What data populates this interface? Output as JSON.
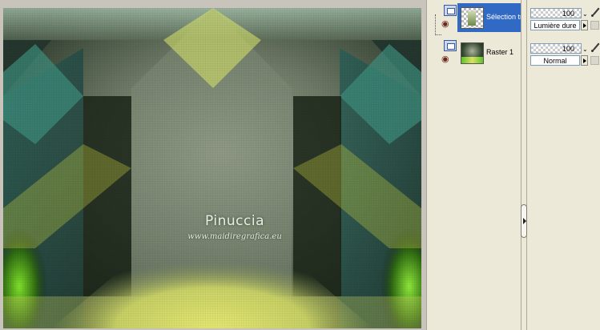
{
  "canvas": {
    "watermark_title": "Pinuccia",
    "watermark_subtitle": "www.maidiregrafica.eu"
  },
  "layers": [
    {
      "name": "Sélection transformée",
      "opacity": "100",
      "blend_mode": "Lumière dure",
      "selected": true,
      "icon": "raster-layer-icon"
    },
    {
      "name": "Raster 1",
      "opacity": "100",
      "blend_mode": "Normal",
      "selected": false,
      "icon": "raster-layer-icon"
    }
  ],
  "colors": {
    "selection": "#316ac5",
    "panel_bg": "#ece9d8",
    "canvas_green": "#4a5a48"
  }
}
